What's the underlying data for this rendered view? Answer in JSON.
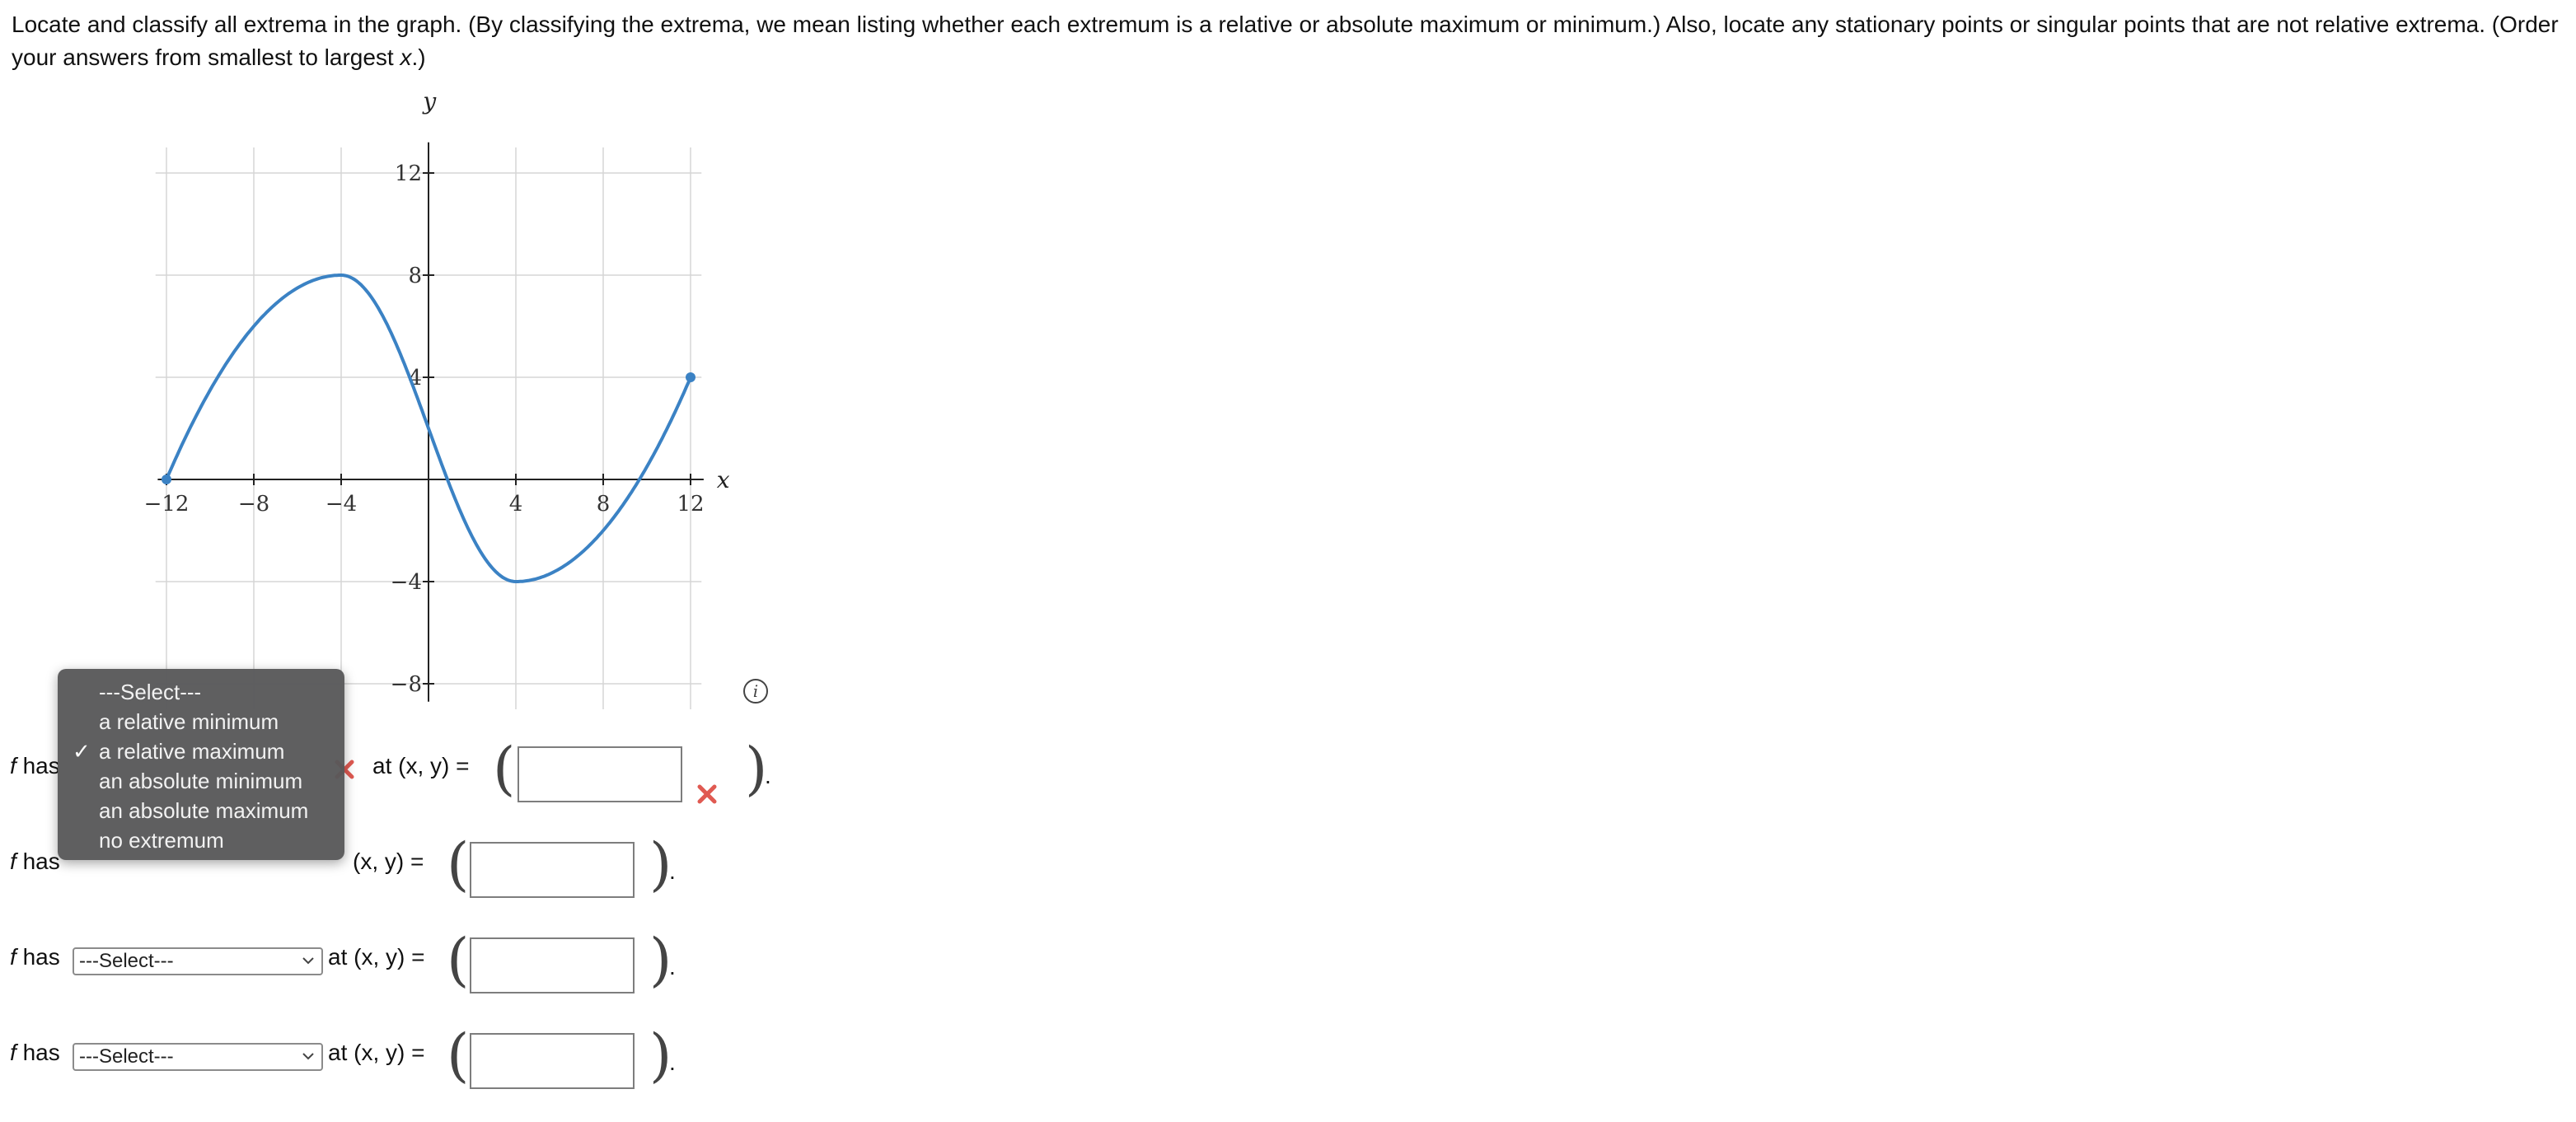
{
  "question": {
    "part1": "Locate and classify all extrema in the graph. (By classifying the extrema, we mean listing whether each extremum is a relative or absolute maximum or minimum.) Also, locate any stationary points or singular points that are not relative extrema. (Order your answers from smallest to largest ",
    "var": "x",
    "part2": ".)"
  },
  "graph": {
    "x_label": "x",
    "y_label": "y",
    "x_ticks": [
      "−12",
      "−8",
      "−4",
      "4",
      "8",
      "12"
    ],
    "y_ticks": [
      "12",
      "8",
      "4",
      "−4",
      "−8"
    ],
    "curve_color": "#3b82c4",
    "grid_color": "#d6d6d6"
  },
  "rows": [
    {
      "prefix": "f",
      "has": "has",
      "select": "",
      "at_label": "at (x, y) =",
      "answer": "",
      "period": "."
    },
    {
      "prefix": "f",
      "has": "has",
      "select": "",
      "at_label": "(x, y) =",
      "answer": "",
      "period": "."
    },
    {
      "prefix": "f",
      "has": "has",
      "select": "---Select---",
      "at_label": "at (x, y) =",
      "answer": "",
      "period": "."
    },
    {
      "prefix": "f",
      "has": "has",
      "select": "---Select---",
      "at_label": "at (x, y) =",
      "answer": "",
      "period": "."
    }
  ],
  "dropdown": {
    "options": [
      "---Select---",
      "a relative minimum",
      "a relative maximum",
      "an absolute minimum",
      "an absolute maximum",
      "no extremum"
    ],
    "selected": "a relative maximum",
    "check": "✓"
  },
  "colors": {
    "error": "#e05a52",
    "text": "#111111"
  }
}
